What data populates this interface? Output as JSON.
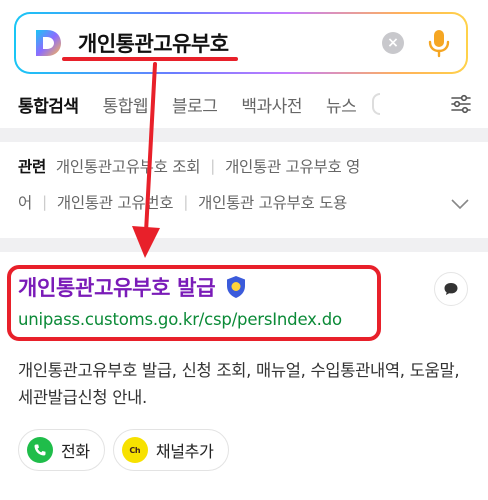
{
  "search": {
    "query": "개인통관고유부호",
    "clear_glyph": "×"
  },
  "tabs": [
    {
      "label": "통합검색",
      "active": true
    },
    {
      "label": "통합웹",
      "active": false
    },
    {
      "label": "블로그",
      "active": false
    },
    {
      "label": "백과사전",
      "active": false
    },
    {
      "label": "뉴스",
      "active": false
    }
  ],
  "related": {
    "title": "관련",
    "line1": [
      "개인통관고유부호 조회",
      "개인통관 고유부호 영"
    ],
    "line2": [
      "어",
      "개인통관 고유번호",
      "개인통관 고유부호 도용"
    ]
  },
  "result": {
    "title": "개인통관고유부호 발급",
    "url": "unipass.customs.go.kr/csp/persIndex.do",
    "description": "개인통관고유부호 발급, 신청 조회, 매뉴얼, 수입통관내역, 도움말, 세관발급신청 안내.",
    "actions": [
      {
        "label": "전화"
      },
      {
        "label": "채널추가",
        "icon_text": "Ch"
      }
    ]
  },
  "colors": {
    "title_purple": "#7a1bb8",
    "url_green": "#0b8a37",
    "annotation_red": "#e8202a"
  }
}
